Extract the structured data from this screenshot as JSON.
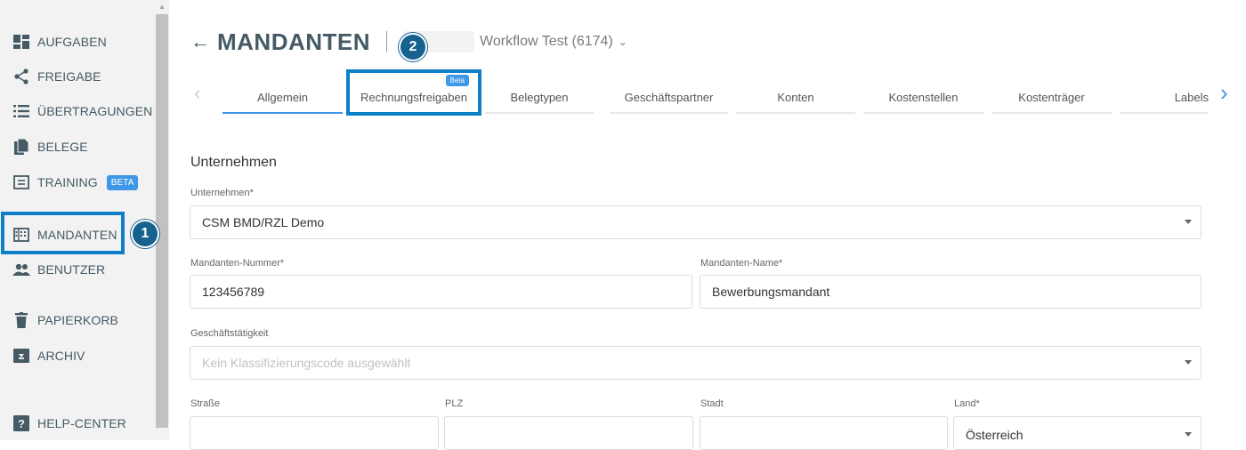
{
  "sidebar": {
    "items": [
      {
        "label": "AUFGABEN",
        "icon": "dashboard-icon"
      },
      {
        "label": "FREIGABE",
        "icon": "share-icon"
      },
      {
        "label": "ÜBERTRAGUNGEN",
        "icon": "list-icon"
      },
      {
        "label": "BELEGE",
        "icon": "documents-icon"
      },
      {
        "label": "TRAINING",
        "icon": "training-icon",
        "badge": "BETA"
      },
      {
        "label": "MANDANTEN",
        "icon": "building-icon"
      },
      {
        "label": "BENUTZER",
        "icon": "users-icon"
      },
      {
        "label": "PAPIERKORB",
        "icon": "trash-icon"
      },
      {
        "label": "ARCHIV",
        "icon": "archive-icon"
      },
      {
        "label": "HELP-CENTER",
        "icon": "help-icon"
      }
    ]
  },
  "annotations": {
    "step1": "1",
    "step2": "2"
  },
  "header": {
    "back": "←",
    "title": "MANDANTEN",
    "client": "Workflow Test (6174)",
    "chevron": "⌄"
  },
  "tabs": [
    {
      "label": "Allgemein",
      "active": true
    },
    {
      "label": "Rechnungsfreigaben",
      "badge": "Beta"
    },
    {
      "label": "Belegtypen"
    },
    {
      "label": "Geschäftspartner"
    },
    {
      "label": "Konten"
    },
    {
      "label": "Kostenstellen"
    },
    {
      "label": "Kostenträger"
    },
    {
      "label": "Labels"
    }
  ],
  "carousel": {
    "prev": "‹",
    "next": "›"
  },
  "form": {
    "section_title": "Unternehmen",
    "company_label": "Unternehmen*",
    "company_value": "CSM BMD/RZL Demo",
    "number_label": "Mandanten-Nummer*",
    "number_value": "123456789",
    "name_label": "Mandanten-Name*",
    "name_value": "Bewerbungsmandant",
    "activity_label": "Geschäftstätigkeit",
    "activity_placeholder": "Kein Klassifizierungscode ausgewählt",
    "street_label": "Straße",
    "zip_label": "PLZ",
    "city_label": "Stadt",
    "country_label": "Land*",
    "country_value": "Österreich"
  },
  "colors": {
    "accent": "#3f97e8",
    "highlight": "#0d7fc8",
    "step": "#17618f",
    "nav": "#455a64"
  }
}
